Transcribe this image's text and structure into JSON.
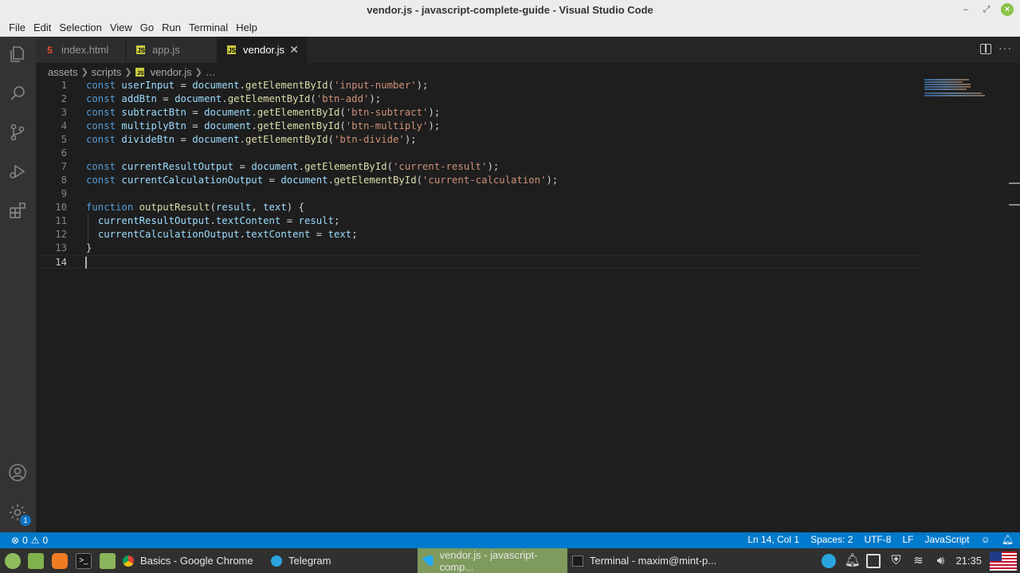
{
  "window": {
    "title": "vendor.js - javascript-complete-guide - Visual Studio Code"
  },
  "menu": [
    "File",
    "Edit",
    "Selection",
    "View",
    "Go",
    "Run",
    "Terminal",
    "Help"
  ],
  "tabs": [
    {
      "label": "index.html",
      "icon": "html-file-icon"
    },
    {
      "label": "app.js",
      "icon": "js-file-icon"
    },
    {
      "label": "vendor.js",
      "icon": "js-file-icon",
      "active": true,
      "close": "✕"
    }
  ],
  "breadcrumb": {
    "seg1": "assets",
    "seg2": "scripts",
    "file": "vendor.js",
    "ellipsis": "…"
  },
  "editor": {
    "line_numbers": [
      "1",
      "2",
      "3",
      "4",
      "5",
      "6",
      "7",
      "8",
      "9",
      "10",
      "11",
      "12",
      "13",
      "14"
    ],
    "lines": [
      [
        [
          "kw",
          "const "
        ],
        [
          "var",
          "userInput"
        ],
        [
          "pl",
          " = "
        ],
        [
          "var",
          "document"
        ],
        [
          "pl",
          "."
        ],
        [
          "fn",
          "getElementById"
        ],
        [
          "pl",
          "("
        ],
        [
          "str",
          "'input-number'"
        ],
        [
          "pl",
          ");"
        ]
      ],
      [
        [
          "kw",
          "const "
        ],
        [
          "var",
          "addBtn"
        ],
        [
          "pl",
          " = "
        ],
        [
          "var",
          "document"
        ],
        [
          "pl",
          "."
        ],
        [
          "fn",
          "getElementById"
        ],
        [
          "pl",
          "("
        ],
        [
          "str",
          "'btn-add'"
        ],
        [
          "pl",
          ");"
        ]
      ],
      [
        [
          "kw",
          "const "
        ],
        [
          "var",
          "subtractBtn"
        ],
        [
          "pl",
          " = "
        ],
        [
          "var",
          "document"
        ],
        [
          "pl",
          "."
        ],
        [
          "fn",
          "getElementById"
        ],
        [
          "pl",
          "("
        ],
        [
          "str",
          "'btn-subtract'"
        ],
        [
          "pl",
          ");"
        ]
      ],
      [
        [
          "kw",
          "const "
        ],
        [
          "var",
          "multiplyBtn"
        ],
        [
          "pl",
          " = "
        ],
        [
          "var",
          "document"
        ],
        [
          "pl",
          "."
        ],
        [
          "fn",
          "getElementById"
        ],
        [
          "pl",
          "("
        ],
        [
          "str",
          "'btn-multiply'"
        ],
        [
          "pl",
          ");"
        ]
      ],
      [
        [
          "kw",
          "const "
        ],
        [
          "var",
          "divideBtn"
        ],
        [
          "pl",
          " = "
        ],
        [
          "var",
          "document"
        ],
        [
          "pl",
          "."
        ],
        [
          "fn",
          "getElementById"
        ],
        [
          "pl",
          "("
        ],
        [
          "str",
          "'btn-divide'"
        ],
        [
          "pl",
          ");"
        ]
      ],
      [],
      [
        [
          "kw",
          "const "
        ],
        [
          "var",
          "currentResultOutput"
        ],
        [
          "pl",
          " = "
        ],
        [
          "var",
          "document"
        ],
        [
          "pl",
          "."
        ],
        [
          "fn",
          "getElementById"
        ],
        [
          "pl",
          "("
        ],
        [
          "str",
          "'current-result'"
        ],
        [
          "pl",
          ");"
        ]
      ],
      [
        [
          "kw",
          "const "
        ],
        [
          "var",
          "currentCalculationOutput"
        ],
        [
          "pl",
          " = "
        ],
        [
          "var",
          "document"
        ],
        [
          "pl",
          "."
        ],
        [
          "fn",
          "getElementById"
        ],
        [
          "pl",
          "("
        ],
        [
          "str",
          "'current-calculation'"
        ],
        [
          "pl",
          ");"
        ]
      ],
      [],
      [
        [
          "kw",
          "function "
        ],
        [
          "fn",
          "outputResult"
        ],
        [
          "pl",
          "("
        ],
        [
          "var",
          "result"
        ],
        [
          "pl",
          ", "
        ],
        [
          "var",
          "text"
        ],
        [
          "pl",
          ") {"
        ]
      ],
      [
        [
          "pl",
          "  "
        ],
        [
          "var",
          "currentResultOutput"
        ],
        [
          "pl",
          "."
        ],
        [
          "var",
          "textContent"
        ],
        [
          "pl",
          " = "
        ],
        [
          "var",
          "result"
        ],
        [
          "pl",
          ";"
        ]
      ],
      [
        [
          "pl",
          "  "
        ],
        [
          "var",
          "currentCalculationOutput"
        ],
        [
          "pl",
          "."
        ],
        [
          "var",
          "textContent"
        ],
        [
          "pl",
          " = "
        ],
        [
          "var",
          "text"
        ],
        [
          "pl",
          ";"
        ]
      ],
      [
        [
          "pl",
          "}"
        ]
      ],
      []
    ]
  },
  "status": {
    "errors": "0",
    "warnings": "0",
    "position": "Ln 14, Col 1",
    "spaces": "Spaces: 2",
    "encoding": "UTF-8",
    "eol": "LF",
    "language": "JavaScript"
  },
  "taskbar": {
    "chrome": "Basics - Google Chrome",
    "telegram": "Telegram",
    "vscode": "vendor.js - javascript-comp...",
    "terminal": "Terminal - maxim@mint-p...",
    "clock": "21:35"
  },
  "colors": {
    "statusbar": "#007acc",
    "activity": "#333333",
    "editor": "#1e1e1e",
    "taskbar_active": "#7f9a5d"
  },
  "activity_icons": [
    "explorer-icon",
    "search-icon",
    "source-control-icon",
    "run-debug-icon",
    "extensions-icon",
    "account-icon",
    "settings-gear-icon"
  ],
  "settings_badge": "1"
}
